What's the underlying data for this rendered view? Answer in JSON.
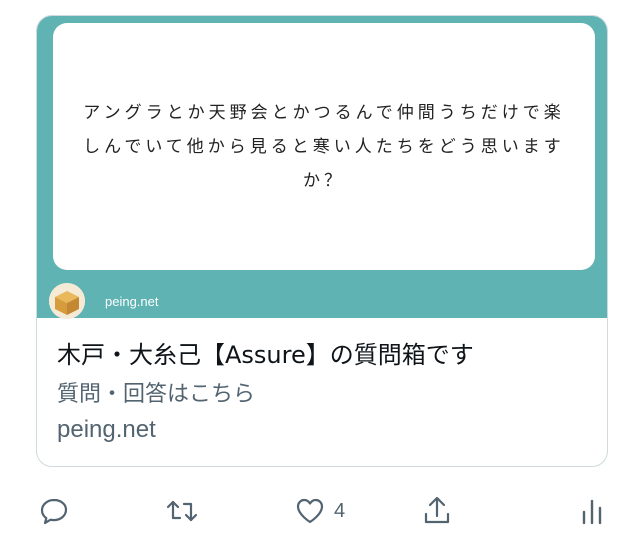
{
  "card": {
    "question": "アングラとか天野会とかつるんで仲間うちだけで楽しんでいて他から見ると寒い人たちをどう思いますか？",
    "site_label": "peing.net",
    "title": "木戸・大糸己【Assure】の質問箱です",
    "description": "質問・回答はこちら",
    "domain": "peing.net"
  },
  "actions": {
    "reply_icon": "speech-bubble-icon",
    "retweet_icon": "retweet-icon",
    "like_icon": "heart-icon",
    "like_count": "4",
    "share_icon": "share-upload-icon",
    "analytics_icon": "bar-chart-icon"
  },
  "colors": {
    "card_accent": "#5fb3b3",
    "icon_gray": "#536471",
    "border": "#cfd9de"
  }
}
